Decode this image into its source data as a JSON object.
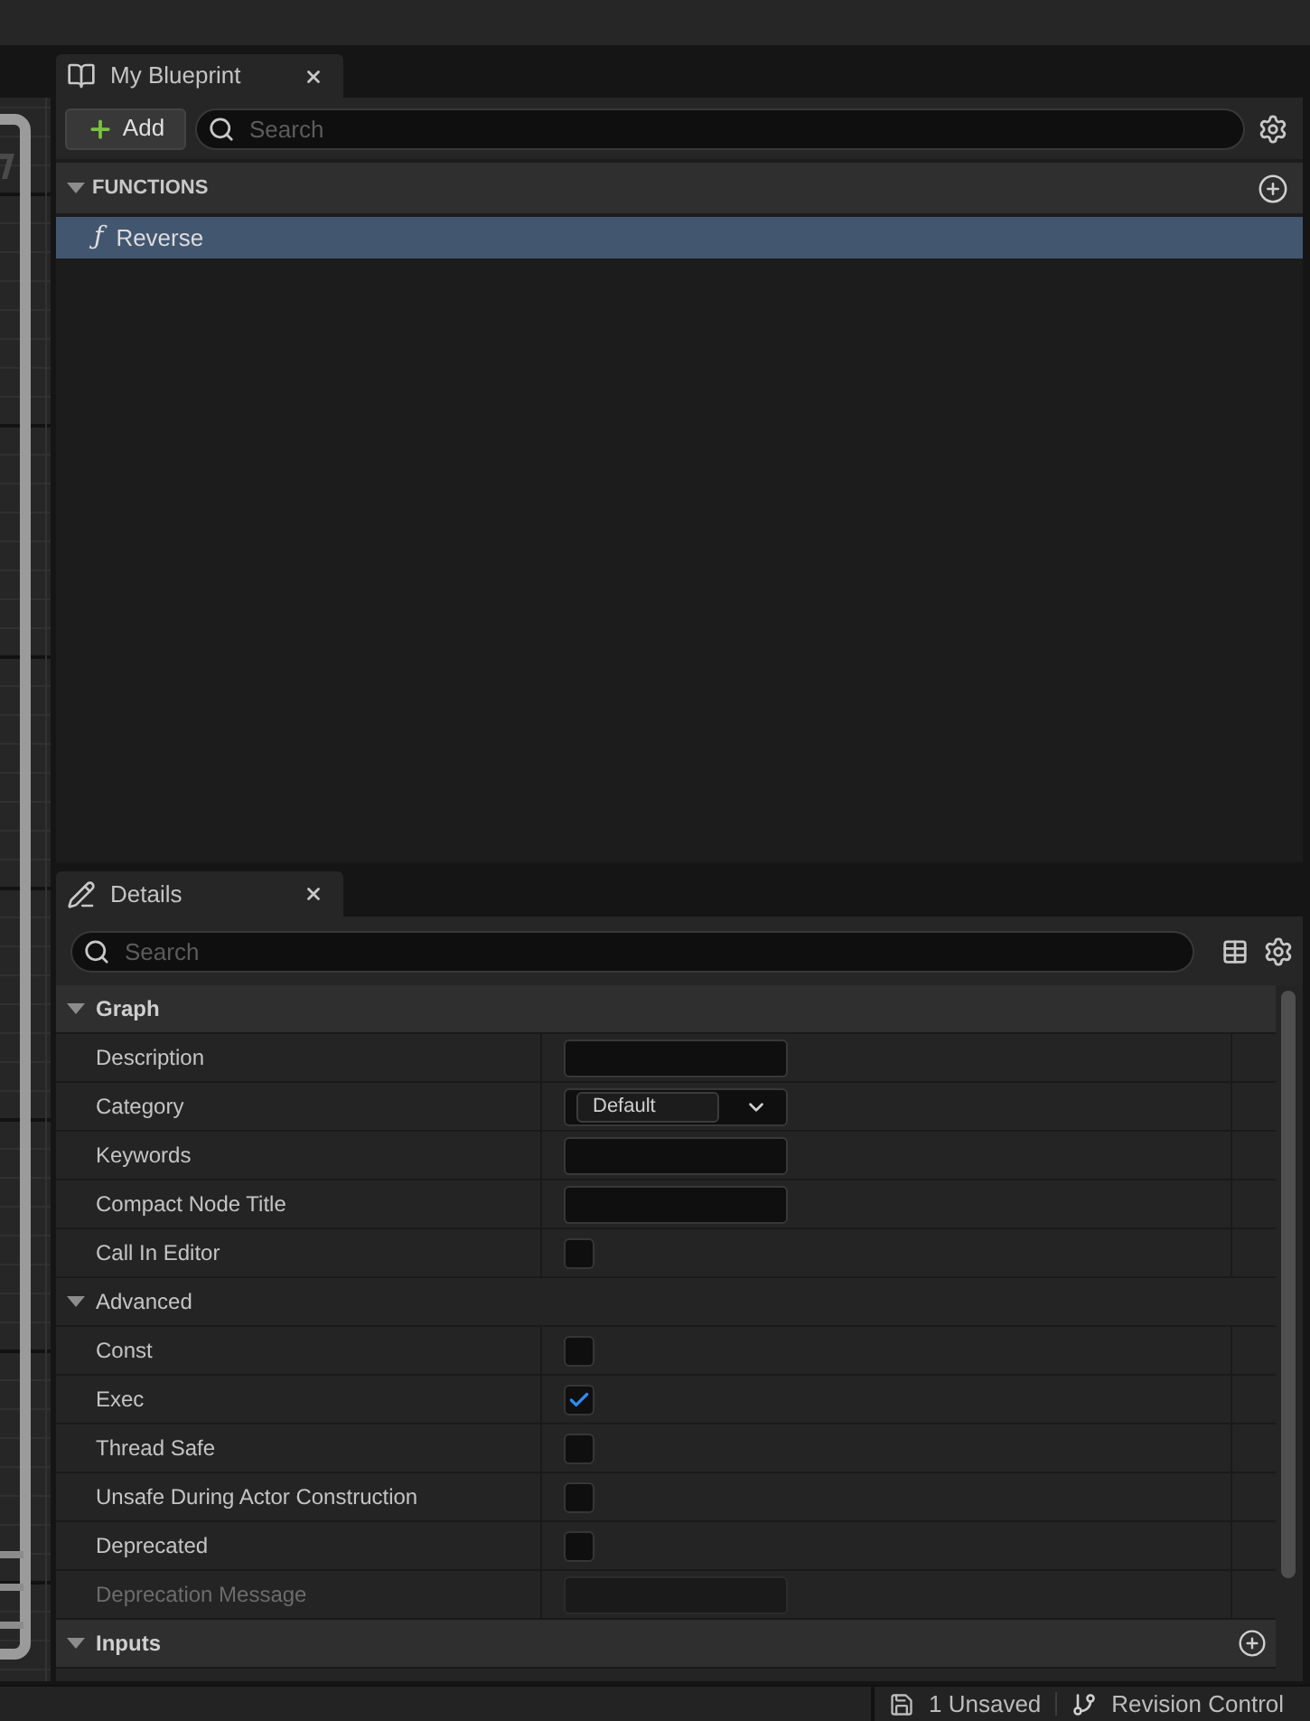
{
  "my_blueprint": {
    "tab": {
      "title": "My Blueprint"
    },
    "add_button": "Add",
    "search": {
      "placeholder": "Search"
    },
    "sections": [
      {
        "title": "FUNCTIONS",
        "expanded": true,
        "add_button": true,
        "items": [
          {
            "icon": "ƒ",
            "label": "Reverse",
            "selected": true
          }
        ]
      }
    ]
  },
  "details": {
    "tab": {
      "title": "Details"
    },
    "search": {
      "placeholder": "Search"
    },
    "categories": [
      {
        "kind": "category",
        "title": "Graph",
        "expanded": true,
        "add_button": false,
        "rows": [
          {
            "kind": "text",
            "label": "Description",
            "disabled": false
          },
          {
            "kind": "combo",
            "label": "Category",
            "value": "Default",
            "disabled": false
          },
          {
            "kind": "text",
            "label": "Keywords",
            "disabled": false
          },
          {
            "kind": "text",
            "label": "Compact Node Title",
            "disabled": false
          },
          {
            "kind": "checkbox",
            "label": "Call In Editor",
            "checked": false,
            "disabled": false
          }
        ]
      },
      {
        "kind": "advanced",
        "title": "Advanced",
        "expanded": true,
        "add_button": false,
        "rows": [
          {
            "kind": "checkbox",
            "label": "Const",
            "checked": false,
            "disabled": false
          },
          {
            "kind": "checkbox",
            "label": "Exec",
            "checked": true,
            "disabled": false
          },
          {
            "kind": "checkbox",
            "label": "Thread Safe",
            "checked": false,
            "disabled": false
          },
          {
            "kind": "checkbox",
            "label": "Unsafe During Actor Construction",
            "checked": false,
            "disabled": false
          },
          {
            "kind": "checkbox",
            "label": "Deprecated",
            "checked": false,
            "disabled": false
          },
          {
            "kind": "text",
            "label": "Deprecation Message",
            "disabled": true
          }
        ]
      },
      {
        "kind": "category",
        "title": "Inputs",
        "expanded": true,
        "add_button": true
      }
    ]
  },
  "status_bar": {
    "items": [
      {
        "kind": "unsaved",
        "label": "1 Unsaved"
      },
      {
        "kind": "revision_control",
        "label": "Revision Control"
      }
    ]
  }
}
